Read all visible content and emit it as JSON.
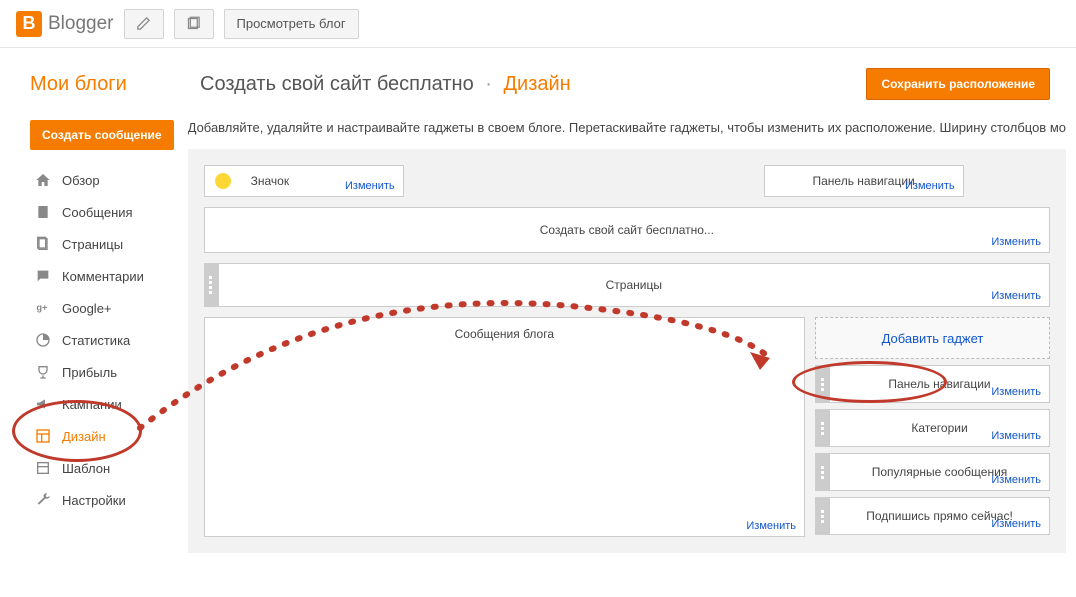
{
  "header": {
    "brand": "Blogger",
    "preview_label": "Просмотреть блог"
  },
  "top": {
    "my_blogs": "Мои блоги",
    "blog_title": "Создать свой сайт бесплатно",
    "section": "Дизайн",
    "save": "Сохранить расположение"
  },
  "sidebar": {
    "create_post": "Создать сообщение",
    "items": [
      {
        "label": "Обзор"
      },
      {
        "label": "Сообщения"
      },
      {
        "label": "Страницы"
      },
      {
        "label": "Комментарии"
      },
      {
        "label": "Google+"
      },
      {
        "label": "Статистика"
      },
      {
        "label": "Прибыль"
      },
      {
        "label": "Кампании"
      },
      {
        "label": "Дизайн"
      },
      {
        "label": "Шаблон"
      },
      {
        "label": "Настройки"
      }
    ]
  },
  "content": {
    "intro": "Добавляйте, удаляйте и настраивайте гаджеты в своем блоге. Перетаскивайте гаджеты, чтобы изменить их расположение. Ширину столбцов мо",
    "edit": "Изменить",
    "favicon": "Значок",
    "navbar": "Панель навигации",
    "header_title": "Создать свой сайт бесплатно...",
    "pages": "Страницы",
    "blog_posts": "Сообщения блога",
    "add_gadget": "Добавить гаджет",
    "side": [
      {
        "label": "Панель навигации"
      },
      {
        "label": "Категории"
      },
      {
        "label": "Популярные сообщения"
      },
      {
        "label": "Подпишись прямо сейчас!"
      }
    ]
  }
}
